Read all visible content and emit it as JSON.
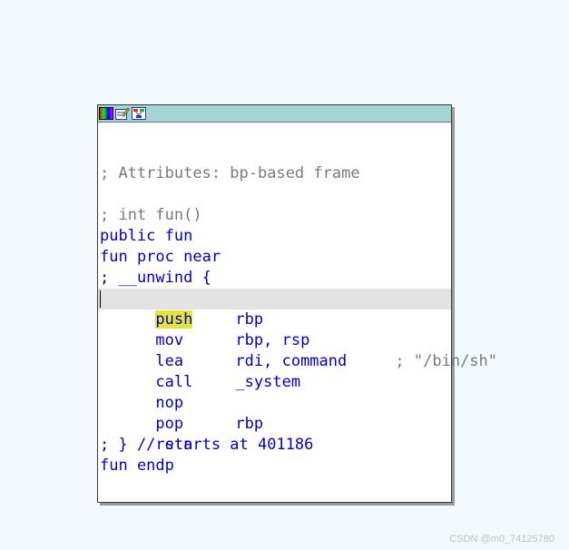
{
  "node": {
    "icons": [
      "palette-icon",
      "edit-icon",
      "graph-icon"
    ]
  },
  "code": {
    "attributes": "; Attributes: bp-based frame",
    "signature": "; int fun()",
    "public": "public fun",
    "proc": "fun proc near",
    "unwind": "; __unwind {",
    "instructions": [
      {
        "mnemonic": "push",
        "operands": "rbp",
        "comment": ""
      },
      {
        "mnemonic": "mov",
        "operands": "rbp, rsp",
        "comment": ""
      },
      {
        "mnemonic": "lea",
        "operands": "rdi, command",
        "comment": "; \"/bin/sh\""
      },
      {
        "mnemonic": "call",
        "operands": "_system",
        "comment": ""
      },
      {
        "mnemonic": "nop",
        "operands": "",
        "comment": ""
      },
      {
        "mnemonic": "pop",
        "operands": "rbp",
        "comment": ""
      },
      {
        "mnemonic": "retn",
        "operands": "",
        "comment": ""
      }
    ],
    "unwind_end": "; } // starts at 401186",
    "endp": "fun endp"
  },
  "colors": {
    "keyword": "#0000c8",
    "comment": "#7a7a7a",
    "highlight": "#e4e43c",
    "titlebar": "#a6d3d6"
  },
  "watermark": "CSDN @m0_74125780"
}
